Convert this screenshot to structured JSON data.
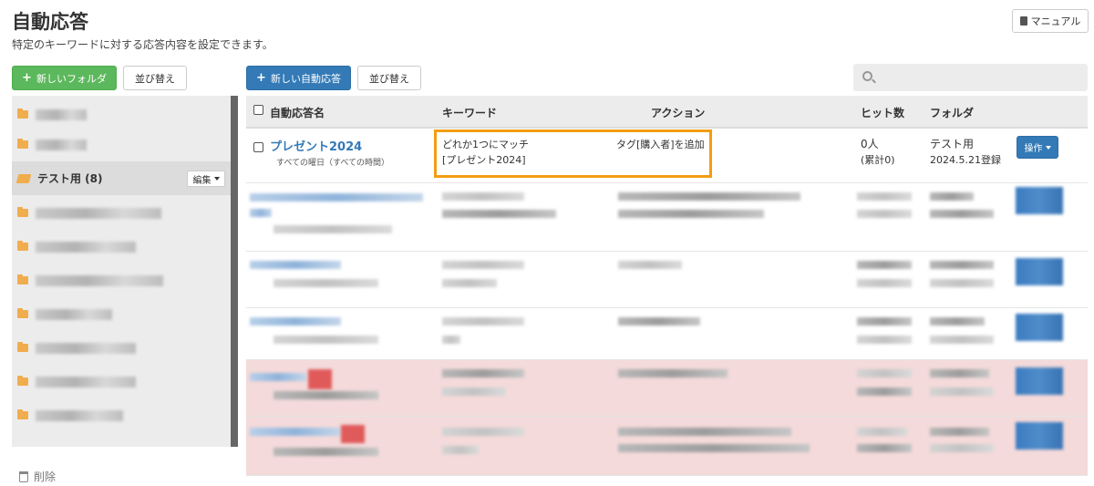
{
  "header": {
    "title": "自動応答",
    "description": "特定のキーワードに対する応答内容を設定できます。",
    "manual_label": "マニュアル"
  },
  "toolbar": {
    "new_folder_label": "新しいフォルダ",
    "sort_folders_label": "並び替え",
    "new_auto_reply_label": "新しい自動応答",
    "sort_replies_label": "並び替え"
  },
  "search": {
    "placeholder": ""
  },
  "sidebar": {
    "active_folder": {
      "label": "テスト用 (8)",
      "edit_label": "編集"
    },
    "delete_label": "削除"
  },
  "table": {
    "columns": {
      "name": "自動応答名",
      "keyword": "キーワード",
      "action": "アクション",
      "hits": "ヒット数",
      "folder": "フォルダ"
    },
    "rows": [
      {
        "name": "プレゼント2024",
        "schedule": "すべての曜日（すべての時間）",
        "match_type": "どれか1つにマッチ",
        "keyword": "[プレゼント2024]",
        "action": "タグ[購入者]を追加",
        "hits": "0人",
        "hits_total": "(累計0)",
        "folder": "テスト用",
        "registered": "2024.5.21登録",
        "ops_label": "操作"
      }
    ]
  },
  "colors": {
    "primary": "#337ab7",
    "success": "#5cb85c",
    "highlight": "#f39c12",
    "folder": "#f0ad4e",
    "row_pink": "#f4dada"
  }
}
